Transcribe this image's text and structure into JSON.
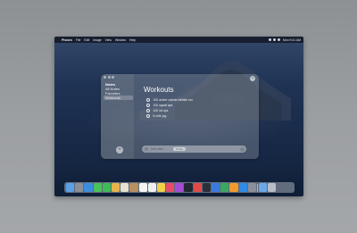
{
  "menubar": {
    "app": "Phases",
    "items": [
      "File",
      "Edit",
      "Image",
      "View",
      "Window",
      "Help"
    ],
    "clock": "Mon 9:41 AM"
  },
  "sidebar": {
    "items": [
      {
        "label": "Notes"
      },
      {
        "label": "All Notes"
      },
      {
        "label": "Favorites"
      },
      {
        "label": "Workouts"
      }
    ],
    "add_icon": "plus-icon"
  },
  "main": {
    "title": "Workouts",
    "tasks": [
      "100 active calorie Airbike run",
      "100 squat ups",
      "100 sit ups",
      "5 mile jog"
    ],
    "input": {
      "placeholder": "New task",
      "tag": "Today"
    }
  },
  "colors": {
    "wallpaper": "#1f3354",
    "window_glass": "#a5aab4"
  },
  "dock": {
    "icons": [
      "finder-icon",
      "launchpad-icon",
      "safari-icon",
      "messages-icon",
      "facetime-icon",
      "maps-icon",
      "photos-icon",
      "contacts-icon",
      "calendar-icon",
      "reminders-icon",
      "notes-icon",
      "music-icon",
      "podcasts-icon",
      "tv-icon",
      "news-icon",
      "stocks-icon",
      "keynote-icon",
      "numbers-icon",
      "pages-icon",
      "app-store-icon",
      "settings-icon",
      "folder-icon",
      "trash-icon"
    ]
  }
}
